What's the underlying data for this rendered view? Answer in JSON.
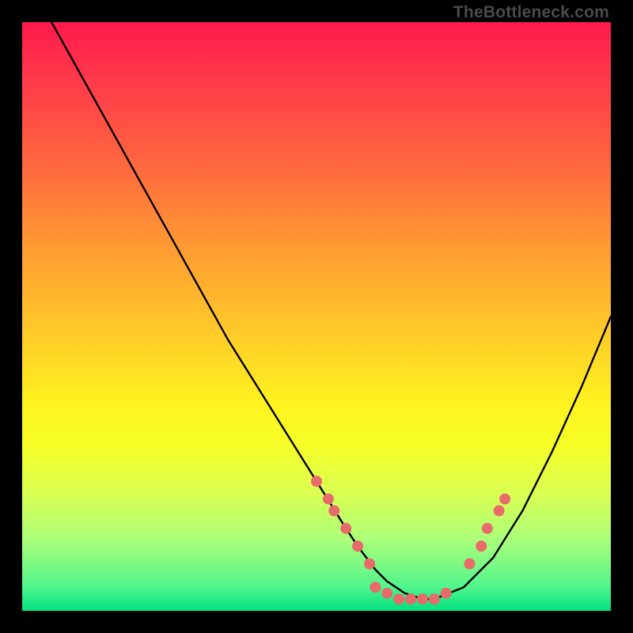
{
  "attribution": "TheBottleneck.com",
  "chart_data": {
    "type": "line",
    "title": "",
    "xlabel": "",
    "ylabel": "",
    "xlim": [
      0,
      100
    ],
    "ylim": [
      0,
      100
    ],
    "curve": {
      "name": "bottleneck-curve",
      "x": [
        5,
        10,
        15,
        20,
        25,
        30,
        35,
        40,
        45,
        50,
        55,
        57,
        60,
        62,
        65,
        68,
        70,
        75,
        80,
        85,
        90,
        95,
        100
      ],
      "y": [
        100,
        91,
        82,
        73,
        64,
        55,
        46,
        38,
        30,
        22,
        14,
        11,
        7,
        5,
        3,
        2,
        2,
        4,
        9,
        17,
        27,
        38,
        50
      ]
    },
    "markers": {
      "name": "highlight-dots",
      "color": "#e86a6a",
      "radius_px": 7,
      "points": [
        {
          "x": 50,
          "y": 22
        },
        {
          "x": 52,
          "y": 19
        },
        {
          "x": 53,
          "y": 17
        },
        {
          "x": 55,
          "y": 14
        },
        {
          "x": 57,
          "y": 11
        },
        {
          "x": 59,
          "y": 8
        },
        {
          "x": 60,
          "y": 4
        },
        {
          "x": 62,
          "y": 3
        },
        {
          "x": 64,
          "y": 2
        },
        {
          "x": 66,
          "y": 2
        },
        {
          "x": 68,
          "y": 2
        },
        {
          "x": 70,
          "y": 2
        },
        {
          "x": 72,
          "y": 3
        },
        {
          "x": 76,
          "y": 8
        },
        {
          "x": 78,
          "y": 11
        },
        {
          "x": 79,
          "y": 14
        },
        {
          "x": 81,
          "y": 17
        },
        {
          "x": 82,
          "y": 19
        }
      ]
    }
  }
}
